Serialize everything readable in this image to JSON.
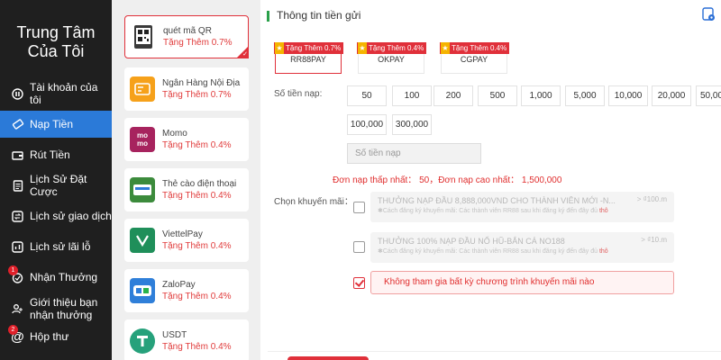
{
  "sidebar": {
    "title": "Trung Tâm Của Tôi",
    "items": [
      {
        "label": "Tài khoản của tôi",
        "icon": "account-icon"
      },
      {
        "label": "Nạp Tiền",
        "icon": "ticket-icon",
        "active": true
      },
      {
        "label": "Rút Tiền",
        "icon": "wallet-icon"
      },
      {
        "label": "Lịch Sử Đặt Cược",
        "icon": "document-icon"
      },
      {
        "label": "Lịch sử giao dịch",
        "icon": "transfer-icon"
      },
      {
        "label": "Lịch sử lãi lỗ",
        "icon": "chart-icon"
      },
      {
        "label": "Nhận Thưởng",
        "icon": "gift-icon",
        "badge": "1"
      },
      {
        "label": "Giới thiệu bạn nhận thưởng",
        "icon": "user-plus-icon"
      },
      {
        "label": "Hộp thư",
        "icon": "at-icon",
        "badge": "2"
      }
    ]
  },
  "methods": [
    {
      "name": "quét mã QR",
      "bonus": "Tặng Thêm 0.7%",
      "icon": "qr-icon",
      "selected": true
    },
    {
      "name": "Ngân Hàng Nội Địa",
      "bonus": "Tặng Thêm 0.7%",
      "icon": "bank-icon"
    },
    {
      "name": "Momo",
      "bonus": "Tặng Thêm 0.4%",
      "icon": "momo-icon"
    },
    {
      "name": "Thẻ cào điện thoại",
      "bonus": "Tặng Thêm 0.4%",
      "icon": "phone-card-icon"
    },
    {
      "name": "ViettelPay",
      "bonus": "Tặng Thêm 0.4%",
      "icon": "viettelpay-icon"
    },
    {
      "name": "ZaloPay",
      "bonus": "Tặng Thêm 0.4%",
      "icon": "zalopay-icon"
    },
    {
      "name": "USDT",
      "bonus": "Tặng Thêm 0.4%",
      "icon": "usdt-icon"
    }
  ],
  "main": {
    "header": "Thông tin tiền gửi",
    "gateways": [
      {
        "tag": "Tặng Thêm 0.7%",
        "name": "RR88PAY",
        "selected": true
      },
      {
        "tag": "Tặng Thêm 0.4%",
        "name": "OKPAY"
      },
      {
        "tag": "Tặng Thêm 0.4%",
        "name": "CGPAY"
      }
    ],
    "amount_label": "Số tiền nạp:",
    "amounts": [
      "50",
      "100",
      "200",
      "500",
      "1,000",
      "5,000",
      "10,000",
      "20,000",
      "50,00",
      "100,000",
      "300,000"
    ],
    "amount_placeholder": "Số tiền nạp",
    "limit_min": "Đơn nạp thấp nhất： 50",
    "limit_sep": "，",
    "limit_max": "Đơn nạp cao nhất： 1,500,000",
    "promo_label": "Chọn khuyến mãi：",
    "promos": [
      {
        "title": "THƯỞNG NẠP ĐẦU 8,888,000VND CHO THÀNH VIÊN MỚI -N...",
        "right": "> ₫100.m",
        "sub": "✱Cách đăng ký khuyến mãi: Các thành viên RR88 sau khi đăng ký đến đây đủ ",
        "sub_link": "thô"
      },
      {
        "title": "THƯỞNG 100% NẠP ĐẦU NỔ HŨ-BẮN CÁ NO188",
        "right": "> ₫10.m",
        "sub": "✱Cách đăng ký khuyến mãi: Các thành viên RR88 sau khi đăng ký đến đây đủ ",
        "sub_link": "thô"
      }
    ],
    "no_promo": "Không tham gia bất kỳ chương trình khuyến mãi nào"
  }
}
